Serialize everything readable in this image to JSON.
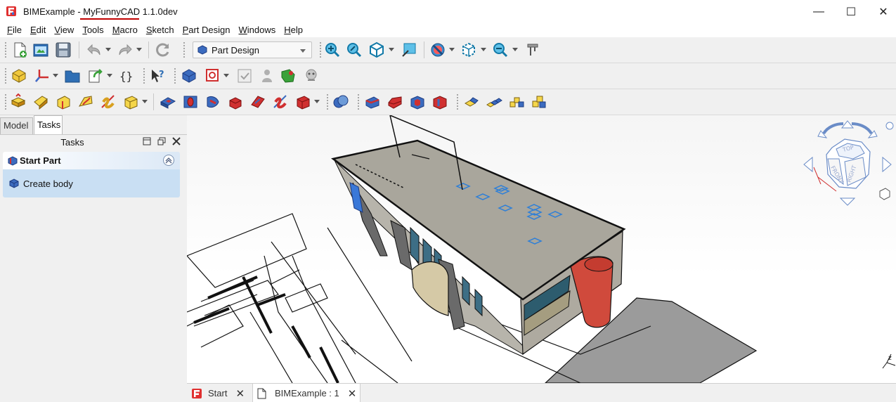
{
  "window": {
    "app_name": "BIMExample",
    "separator": " - ",
    "app_version_name": "MyFunnyCAD",
    "version": " 1.1.0dev",
    "minimize_glyph": "—",
    "maximize_glyph": "☐",
    "close_glyph": "✕"
  },
  "menu": [
    {
      "label": "File",
      "accel": "F",
      "rest": "ile"
    },
    {
      "label": "Edit",
      "accel": "E",
      "rest": "dit"
    },
    {
      "label": "View",
      "accel": "V",
      "rest": "iew"
    },
    {
      "label": "Tools",
      "accel": "T",
      "rest": "ools"
    },
    {
      "label": "Macro",
      "accel": "M",
      "rest": "acro"
    },
    {
      "label": "Sketch",
      "accel": "S",
      "rest": "ketch"
    },
    {
      "label": "Part Design",
      "accel": "P",
      "rest": "art Design"
    },
    {
      "label": "Windows",
      "accel": "W",
      "rest": "indows"
    },
    {
      "label": "Help",
      "accel": "H",
      "rest": "elp"
    }
  ],
  "workbench_selector": {
    "value": "Part Design"
  },
  "left_panel": {
    "tabs": [
      "Model",
      "Tasks"
    ],
    "active_tab": "Tasks",
    "header_title": "Tasks",
    "task_section": {
      "title": "Start Part",
      "action": "Create body"
    }
  },
  "doc_tabs": [
    {
      "label": "Start"
    },
    {
      "label": "BIMExample : 1"
    }
  ],
  "navicube": {
    "faces": [
      "TOP",
      "FRONT",
      "RIGHT"
    ]
  },
  "colors": {
    "accent_blue": "#2d7fd8",
    "title_underline": "#c00000",
    "task_body_bg": "#c9dff3",
    "building_roof": "#a9a69c",
    "building_wall": "#b7b4ab",
    "cylinder_red": "#d04a3c"
  }
}
